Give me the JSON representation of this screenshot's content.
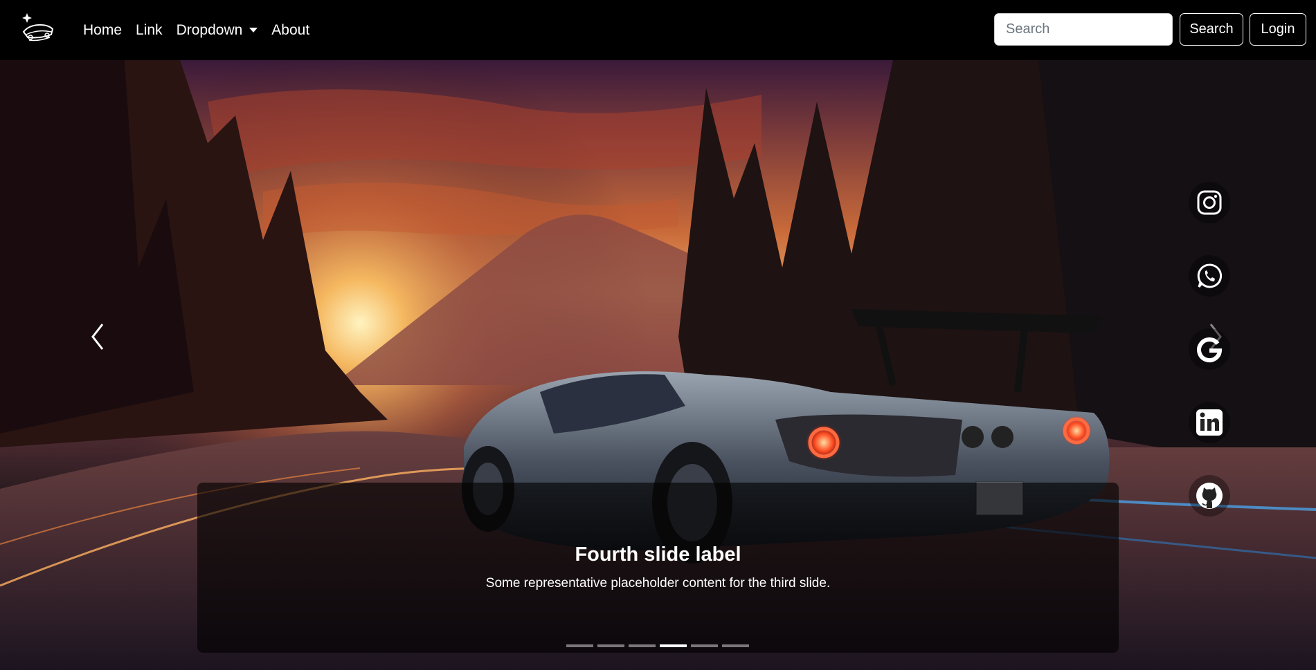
{
  "navbar": {
    "brand_icon": "car-logo-icon",
    "links": [
      {
        "label": "Home"
      },
      {
        "label": "Link"
      },
      {
        "label": "Dropdown"
      },
      {
        "label": "About"
      }
    ],
    "search": {
      "placeholder": "Search",
      "value": ""
    },
    "search_button": "Search",
    "login_button": "Login"
  },
  "carousel": {
    "slide_title": "Fourth slide label",
    "slide_text": "Some representative placeholder content for the third slide.",
    "slide_count": 6,
    "active_index": 3,
    "prev_icon": "chevron-left-icon",
    "next_icon": "chevron-right-icon"
  },
  "social": [
    {
      "name": "instagram-icon"
    },
    {
      "name": "whatsapp-icon"
    },
    {
      "name": "google-icon"
    },
    {
      "name": "linkedin-icon"
    },
    {
      "name": "github-icon"
    }
  ],
  "colors": {
    "navbar_bg": "#000000",
    "caption_bg": "rgba(0,0,0,0.62)",
    "accent": "#ffffff"
  }
}
